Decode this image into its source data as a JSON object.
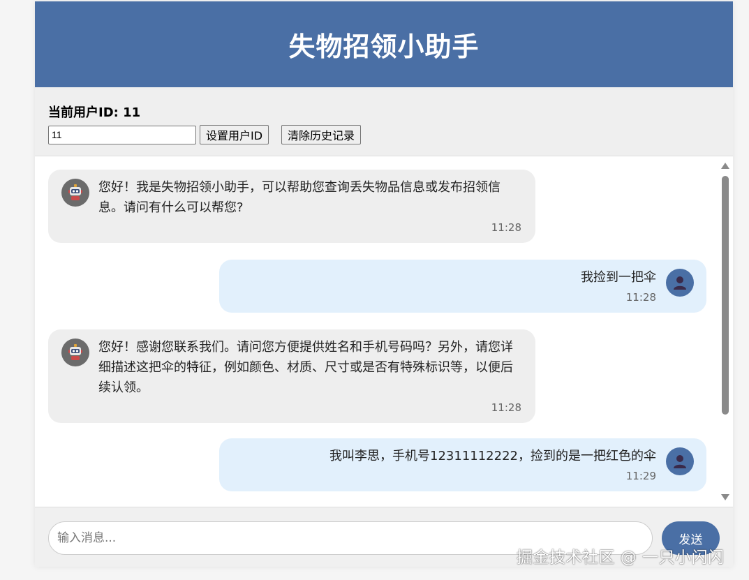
{
  "header": {
    "title": "失物招领小助手"
  },
  "user_bar": {
    "current_label": "当前用户ID: ",
    "current_id": "11",
    "input_value": "11",
    "set_button": "设置用户ID",
    "clear_button": "清除历史记录"
  },
  "messages": [
    {
      "role": "bot",
      "text": "您好！我是失物招领小助手，可以帮助您查询丢失物品信息或发布招领信息。请问有什么可以帮您?",
      "time": "11:28",
      "icon": "robot-icon"
    },
    {
      "role": "user",
      "text": "我捡到一把伞",
      "time": "11:28",
      "icon": "user-icon"
    },
    {
      "role": "bot",
      "text": "您好！感谢您联系我们。请问您方便提供姓名和手机号码吗？另外，请您详细描述这把伞的特征，例如颜色、材质、尺寸或是否有特殊标识等，以便后续认领。",
      "time": "11:28",
      "icon": "robot-icon"
    },
    {
      "role": "user",
      "text": "我叫李思，手机号12311112222，捡到的是一把红色的伞",
      "time": "11:29",
      "icon": "user-icon"
    }
  ],
  "composer": {
    "placeholder": "输入消息...",
    "send_label": "发送"
  },
  "watermark": "掘金技术社区 @ 一只小闪闪",
  "colors": {
    "header": "#4a6fa5",
    "bot_bubble": "#eeeeee",
    "user_bubble": "#e2f0fc",
    "send_button": "#4a6fa5"
  }
}
